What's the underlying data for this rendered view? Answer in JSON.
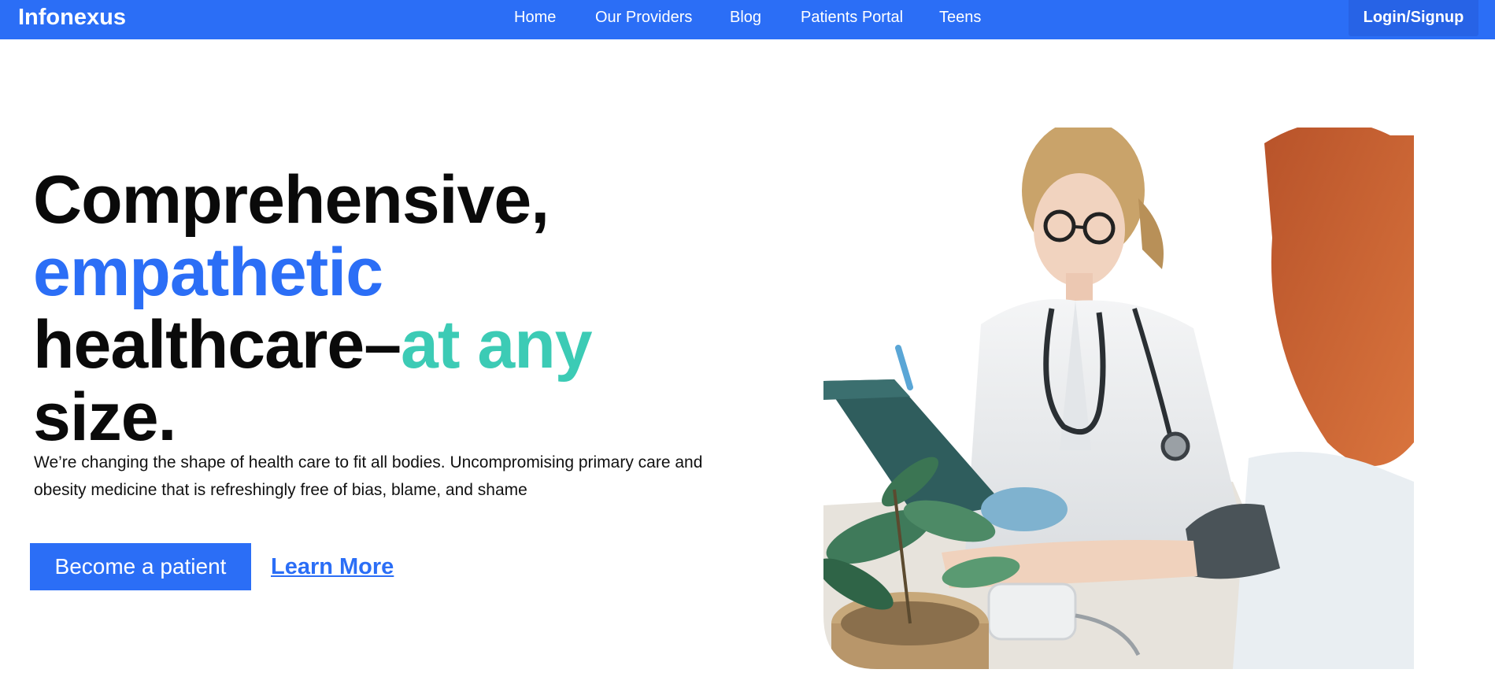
{
  "navbar": {
    "brand": "Infonexus",
    "links": [
      {
        "label": "Home"
      },
      {
        "label": "Our Providers"
      },
      {
        "label": "Blog"
      },
      {
        "label": "Patients Portal"
      },
      {
        "label": "Teens"
      }
    ],
    "login_label": "Login/Signup"
  },
  "hero": {
    "title": {
      "part1": "Comprehensive,",
      "part2": "empathetic",
      "part3": "healthcare–",
      "part4": "at any",
      "part5": "size."
    },
    "subtitle": "We’re changing the shape of health care to fit all bodies. Uncompromising primary care and obesity medicine that is refreshingly free of bias, blame, and shame",
    "primary_button": "Become a patient",
    "secondary_link": "Learn More",
    "image_description": "doctor-with-patient-photo"
  },
  "colors": {
    "brand_blue": "#2b6ef6",
    "accent_teal": "#3ccbb5",
    "text_dark": "#0a0a0a"
  }
}
